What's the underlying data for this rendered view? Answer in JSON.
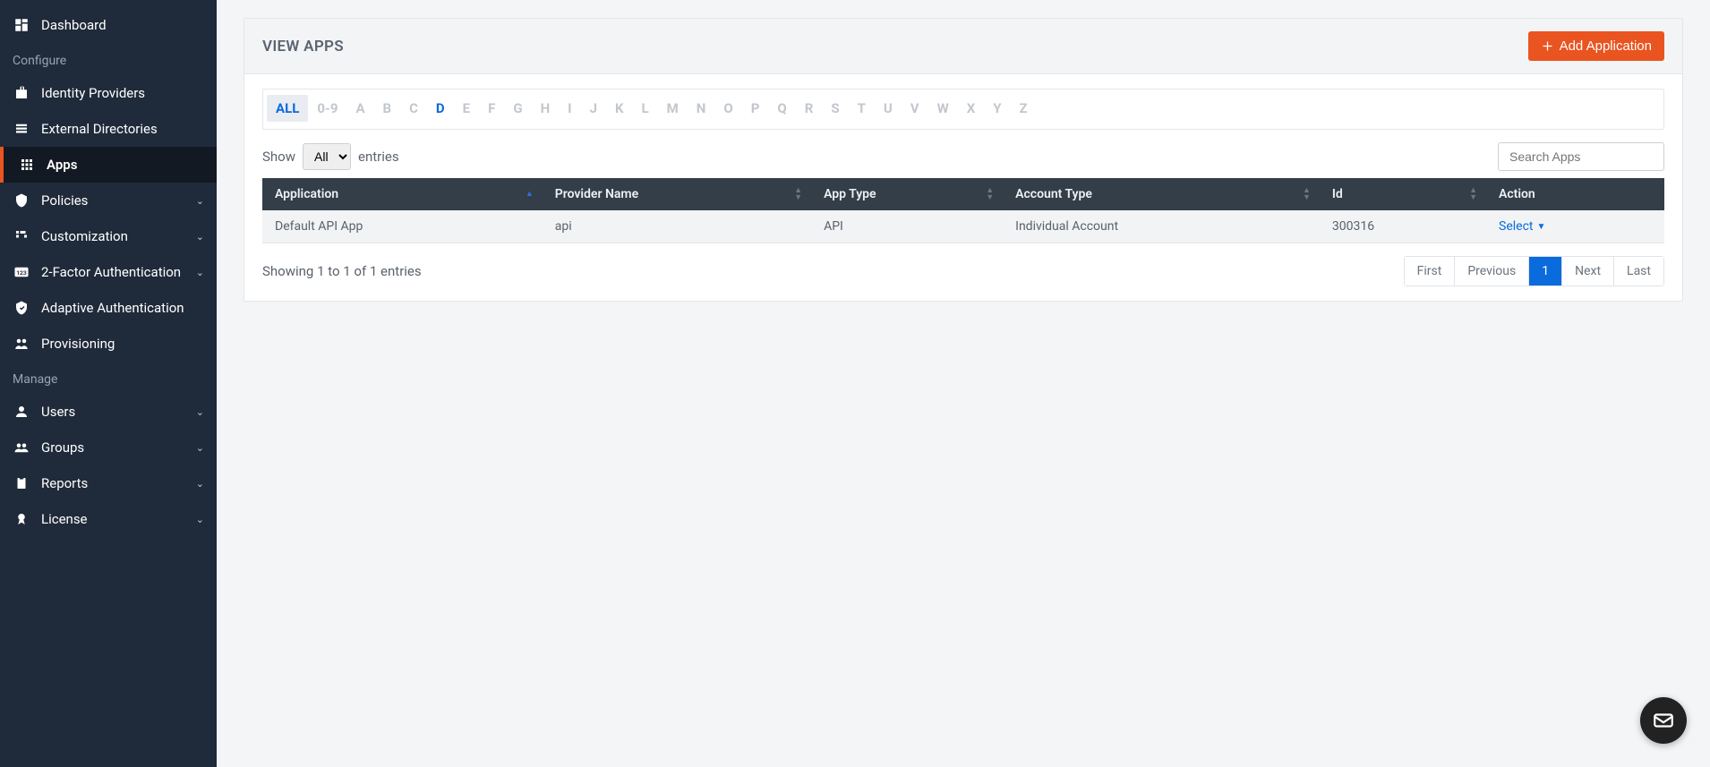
{
  "sidebar": {
    "items": [
      {
        "label": "Dashboard",
        "icon": "dashboard-icon",
        "expandable": false
      },
      {
        "label": "Identity Providers",
        "icon": "identity-icon",
        "expandable": false
      },
      {
        "label": "External Directories",
        "icon": "directory-icon",
        "expandable": false
      },
      {
        "label": "Apps",
        "icon": "apps-icon",
        "expandable": false,
        "active": true
      },
      {
        "label": "Policies",
        "icon": "policy-icon",
        "expandable": true
      },
      {
        "label": "Customization",
        "icon": "custom-icon",
        "expandable": true
      },
      {
        "label": "2-Factor Authentication",
        "icon": "twofa-icon",
        "expandable": true
      },
      {
        "label": "Adaptive Authentication",
        "icon": "adaptive-icon",
        "expandable": false
      },
      {
        "label": "Provisioning",
        "icon": "provision-icon",
        "expandable": false
      },
      {
        "label": "Users",
        "icon": "users-icon",
        "expandable": true
      },
      {
        "label": "Groups",
        "icon": "groups-icon",
        "expandable": true
      },
      {
        "label": "Reports",
        "icon": "reports-icon",
        "expandable": true
      },
      {
        "label": "License",
        "icon": "license-icon",
        "expandable": true
      }
    ],
    "sections": {
      "configure": "Configure",
      "manage": "Manage"
    }
  },
  "header": {
    "title": "VIEW APPS",
    "add_label": "Add Application"
  },
  "filters": {
    "letters": [
      "ALL",
      "0-9",
      "A",
      "B",
      "C",
      "D",
      "E",
      "F",
      "G",
      "H",
      "I",
      "J",
      "K",
      "L",
      "M",
      "N",
      "O",
      "P",
      "Q",
      "R",
      "S",
      "T",
      "U",
      "V",
      "W",
      "X",
      "Y",
      "Z"
    ],
    "active": "ALL",
    "highlighted": "D"
  },
  "table": {
    "show_label_prefix": "Show",
    "show_label_suffix": "entries",
    "show_selected": "All",
    "search_placeholder": "Search Apps",
    "columns": [
      "Application",
      "Provider Name",
      "App Type",
      "Account Type",
      "Id",
      "Action"
    ],
    "rows": [
      {
        "app": "Default API App",
        "provider": "api",
        "type": "API",
        "account": "Individual Account",
        "id": "300316",
        "action": "Select"
      }
    ],
    "footer_info": "Showing 1 to 1 of 1 entries",
    "pagination": {
      "first": "First",
      "prev": "Previous",
      "current": "1",
      "next": "Next",
      "last": "Last"
    }
  }
}
